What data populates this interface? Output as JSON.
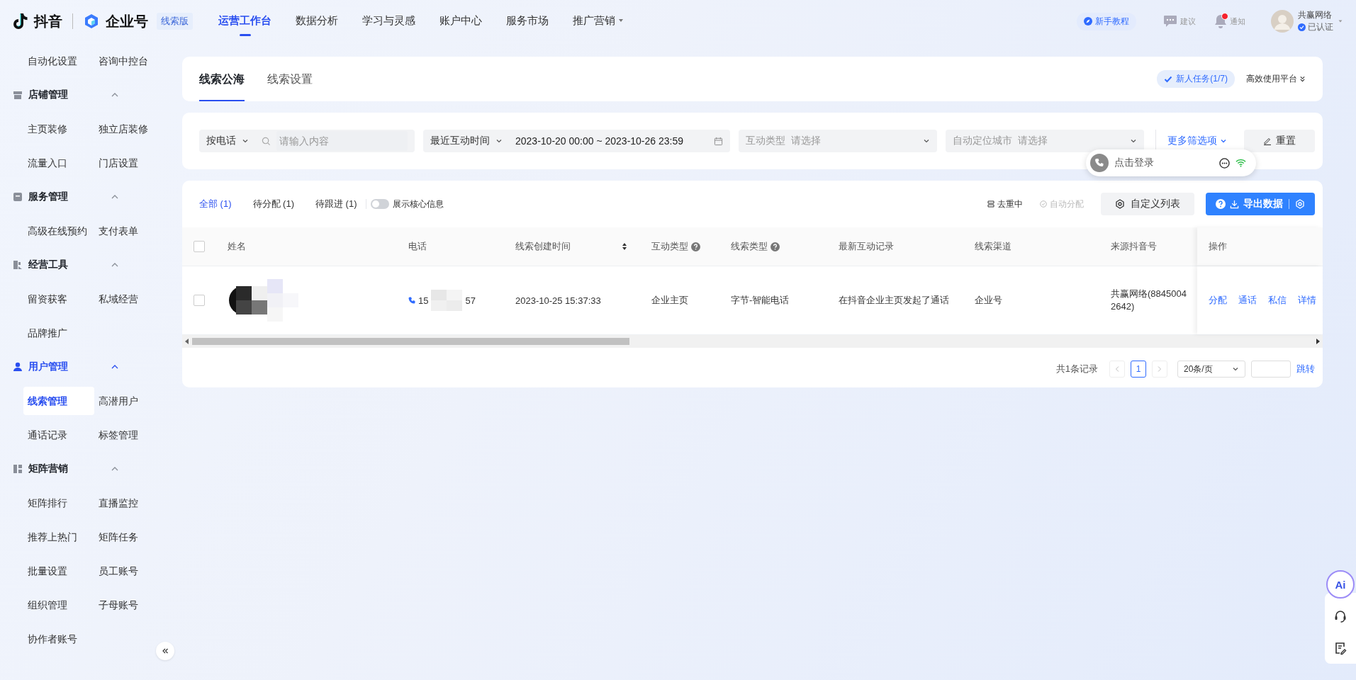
{
  "header": {
    "logo": "抖音",
    "brand": "企业号",
    "edition": "线索版",
    "nav": [
      {
        "label": "运营工作台",
        "selected": true,
        "dropdown": false
      },
      {
        "label": "数据分析",
        "selected": false,
        "dropdown": false
      },
      {
        "label": "学习与灵感",
        "selected": false,
        "dropdown": false
      },
      {
        "label": "账户中心",
        "selected": false,
        "dropdown": false
      },
      {
        "label": "服务市场",
        "selected": false,
        "dropdown": false
      },
      {
        "label": "推广营销",
        "selected": false,
        "dropdown": true
      }
    ],
    "tutorial": "新手教程",
    "feedback": "建议",
    "notice": {
      "label": "通知",
      "unread": true
    },
    "user": {
      "name": "共赢网络",
      "status": "已认证"
    }
  },
  "sidebar": {
    "top_items": [
      {
        "label": "自动化设置",
        "selected": false
      },
      {
        "label": "咨询中控台",
        "selected": false
      }
    ],
    "groups": [
      {
        "title": "店铺管理",
        "kind": "store",
        "active": false,
        "expanded": true,
        "items": [
          {
            "label": "主页装修",
            "selected": false
          },
          {
            "label": "独立店装修",
            "selected": false
          },
          {
            "label": "流量入口",
            "selected": false
          },
          {
            "label": "门店设置",
            "selected": false
          }
        ]
      },
      {
        "title": "服务管理",
        "kind": "box",
        "active": false,
        "expanded": true,
        "items": [
          {
            "label": "高级在线预约",
            "selected": false
          },
          {
            "label": "支付表单",
            "selected": false
          }
        ]
      },
      {
        "title": "经营工具",
        "kind": "tools",
        "active": false,
        "expanded": true,
        "items": [
          {
            "label": "留资获客",
            "selected": false
          },
          {
            "label": "私域经营",
            "selected": false
          },
          {
            "label": "品牌推广",
            "selected": false
          }
        ]
      },
      {
        "title": "用户管理",
        "kind": "user",
        "active": true,
        "expanded": true,
        "items": [
          {
            "label": "线索管理",
            "selected": true
          },
          {
            "label": "高潜用户",
            "selected": false
          },
          {
            "label": "通话记录",
            "selected": false
          },
          {
            "label": "标签管理",
            "selected": false
          }
        ]
      },
      {
        "title": "矩阵营销",
        "kind": "grid",
        "active": false,
        "expanded": true,
        "items": [
          {
            "label": "矩阵排行",
            "selected": false
          },
          {
            "label": "直播监控",
            "selected": false
          },
          {
            "label": "推荐上热门",
            "selected": false
          },
          {
            "label": "矩阵任务",
            "selected": false
          },
          {
            "label": "批量设置",
            "selected": false
          },
          {
            "label": "员工账号",
            "selected": false
          },
          {
            "label": "组织管理",
            "selected": false
          },
          {
            "label": "子母账号",
            "selected": false
          },
          {
            "label": "协作者账号",
            "selected": false
          }
        ]
      }
    ]
  },
  "page_tabs": [
    {
      "label": "线索公海",
      "selected": true
    },
    {
      "label": "线索设置",
      "selected": false
    }
  ],
  "task_badge": "新人任务(1/7)",
  "efficiency": "高效使用平台",
  "filters": {
    "phone_select": "按电话",
    "search_placeholder": "请输入内容",
    "time_select": "最近互动时间",
    "date_range": "2023-10-20 00:00 ~ 2023-10-26 23:59",
    "interaction": {
      "label": "互动类型",
      "placeholder": "请选择"
    },
    "city": {
      "label": "自动定位城市",
      "placeholder": "请选择"
    },
    "more": "更多筛选项",
    "reset": "重置"
  },
  "login_popup": "点击登录",
  "list": {
    "tabs": [
      {
        "label": "全部",
        "count": "(1)",
        "selected": true
      },
      {
        "label": "待分配",
        "count": "(1)",
        "selected": false
      },
      {
        "label": "待跟进",
        "count": "(1)",
        "selected": false
      }
    ],
    "select_all_checked": false,
    "core_toggle": {
      "label": "展示核心信息",
      "on": false
    },
    "dedupe": "去重中",
    "auto_assign": {
      "label": "自动分配",
      "disabled": true
    },
    "custom_columns": "自定义列表",
    "export": "导出数据",
    "columns": [
      {
        "label": "姓名",
        "kind": "plain"
      },
      {
        "label": "电话",
        "kind": "plain"
      },
      {
        "label": "线索创建时间",
        "kind": "sortable"
      },
      {
        "label": "互动类型",
        "kind": "help"
      },
      {
        "label": "线索类型",
        "kind": "help"
      },
      {
        "label": "最新互动记录",
        "kind": "plain"
      },
      {
        "label": "线索渠道",
        "kind": "plain"
      },
      {
        "label": "来源抖音号",
        "kind": "plain"
      },
      {
        "label": "操作",
        "kind": "plain"
      }
    ],
    "rows": [
      {
        "checked": false,
        "phone_start": "15",
        "phone_end": "57",
        "created": "2023-10-25 15:37:33",
        "interaction": "企业主页",
        "lead_type": "字节-智能电话",
        "latest": "在抖音企业主页发起了通话",
        "channel": "企业号",
        "source": "共赢网络(88450042642)",
        "actions": [
          "分配",
          "通话",
          "私信",
          "详情"
        ]
      }
    ],
    "total": "共1条记录",
    "pages": [
      {
        "label": "1",
        "selected": true
      }
    ],
    "page_size": "20条/页",
    "jump": "跳转"
  },
  "assistant": "Ai"
}
